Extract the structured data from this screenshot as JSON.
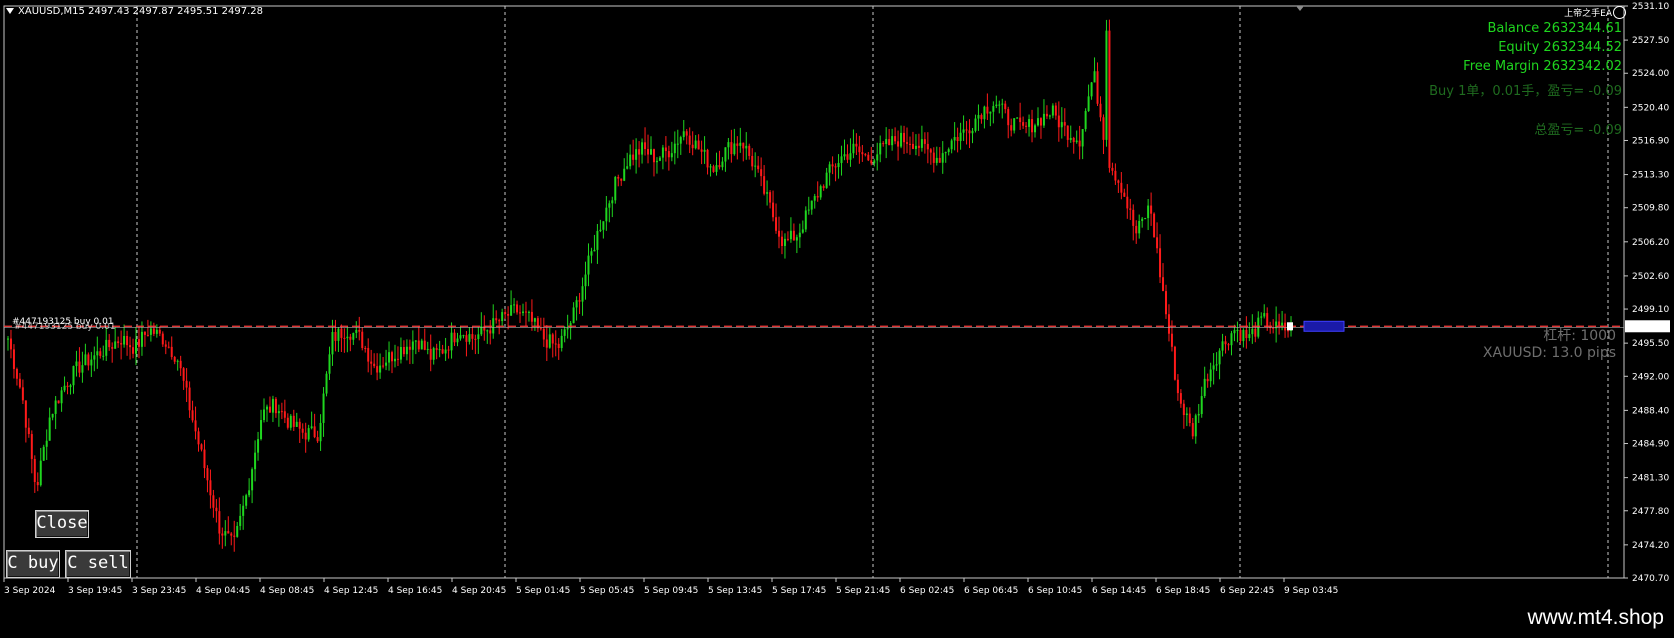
{
  "header": {
    "symbol_info": "XAUUSD,M15  2497.43 2497.87 2495.51 2497.28"
  },
  "ea_name": "上帝之手EA",
  "account": {
    "balance": "Balance 2632344.61",
    "equity": "Equity 2632344.52",
    "free_margin": "Free Margin 2632342.02",
    "position": "Buy 1单，0.01手，盈亏= -0.09",
    "total_pl": "总盈亏= -0.09"
  },
  "leverage": "杠杆: 1000",
  "spread": "XAUUSD: 13.0 pips",
  "order_label_1": "#447193125 buy 0.01",
  "order_label_2": "#447193125 buy 0.01",
  "buttons": {
    "close": "Close",
    "c_buy": "C buy",
    "c_sell": "C sell"
  },
  "current_price_tag": "2497.28",
  "price_axis": [
    "2531.10",
    "2527.50",
    "2524.00",
    "2520.40",
    "2516.90",
    "2513.30",
    "2509.80",
    "2506.20",
    "2502.60",
    "2499.10",
    "2495.50",
    "2492.00",
    "2488.40",
    "2484.90",
    "2481.30",
    "2477.80",
    "2474.20",
    "2470.70"
  ],
  "time_axis": [
    "3 Sep 2024",
    "3 Sep 19:45",
    "3 Sep 23:45",
    "4 Sep 04:45",
    "4 Sep 08:45",
    "4 Sep 12:45",
    "4 Sep 16:45",
    "4 Sep 20:45",
    "5 Sep 01:45",
    "5 Sep 05:45",
    "5 Sep 09:45",
    "5 Sep 13:45",
    "5 Sep 17:45",
    "5 Sep 21:45",
    "6 Sep 02:45",
    "6 Sep 06:45",
    "6 Sep 10:45",
    "6 Sep 14:45",
    "6 Sep 18:45",
    "6 Sep 22:45",
    "9 Sep 03:45"
  ],
  "colors": {
    "up": "#1fd61f",
    "down": "#ff1a1a",
    "grid": "#c8c8c8",
    "order_line": "#ff3b3b"
  },
  "brand": "www.mt4.shop",
  "chart_data": {
    "type": "candlestick",
    "ylim": [
      2470.7,
      2531.1
    ],
    "order_price": 2497.28,
    "close_path": [
      2496,
      2490,
      2480,
      2488,
      2491,
      2493,
      2494,
      2495,
      2496,
      2495,
      2497,
      2496,
      2494,
      2488,
      2482,
      2476,
      2474,
      2480,
      2488,
      2489,
      2487,
      2486,
      2486,
      2496,
      2497,
      2496,
      2493,
      2494,
      2495,
      2496,
      2494,
      2495,
      2497,
      2496,
      2497,
      2498,
      2499,
      2498,
      2496,
      2495,
      2498,
      2503,
      2508,
      2512,
      2515,
      2516,
      2515,
      2516,
      2518,
      2516,
      2514,
      2516,
      2517,
      2514,
      2510,
      2506,
      2507,
      2510,
      2513,
      2515,
      2516,
      2515,
      2516,
      2517,
      2517,
      2516,
      2515,
      2517,
      2518,
      2520,
      2521,
      2519,
      2518,
      2519,
      2520,
      2518,
      2517,
      2524,
      2515,
      2512,
      2507,
      2510,
      2500,
      2490,
      2486,
      2492,
      2495,
      2497,
      2496,
      2498,
      2497,
      2497
    ]
  }
}
